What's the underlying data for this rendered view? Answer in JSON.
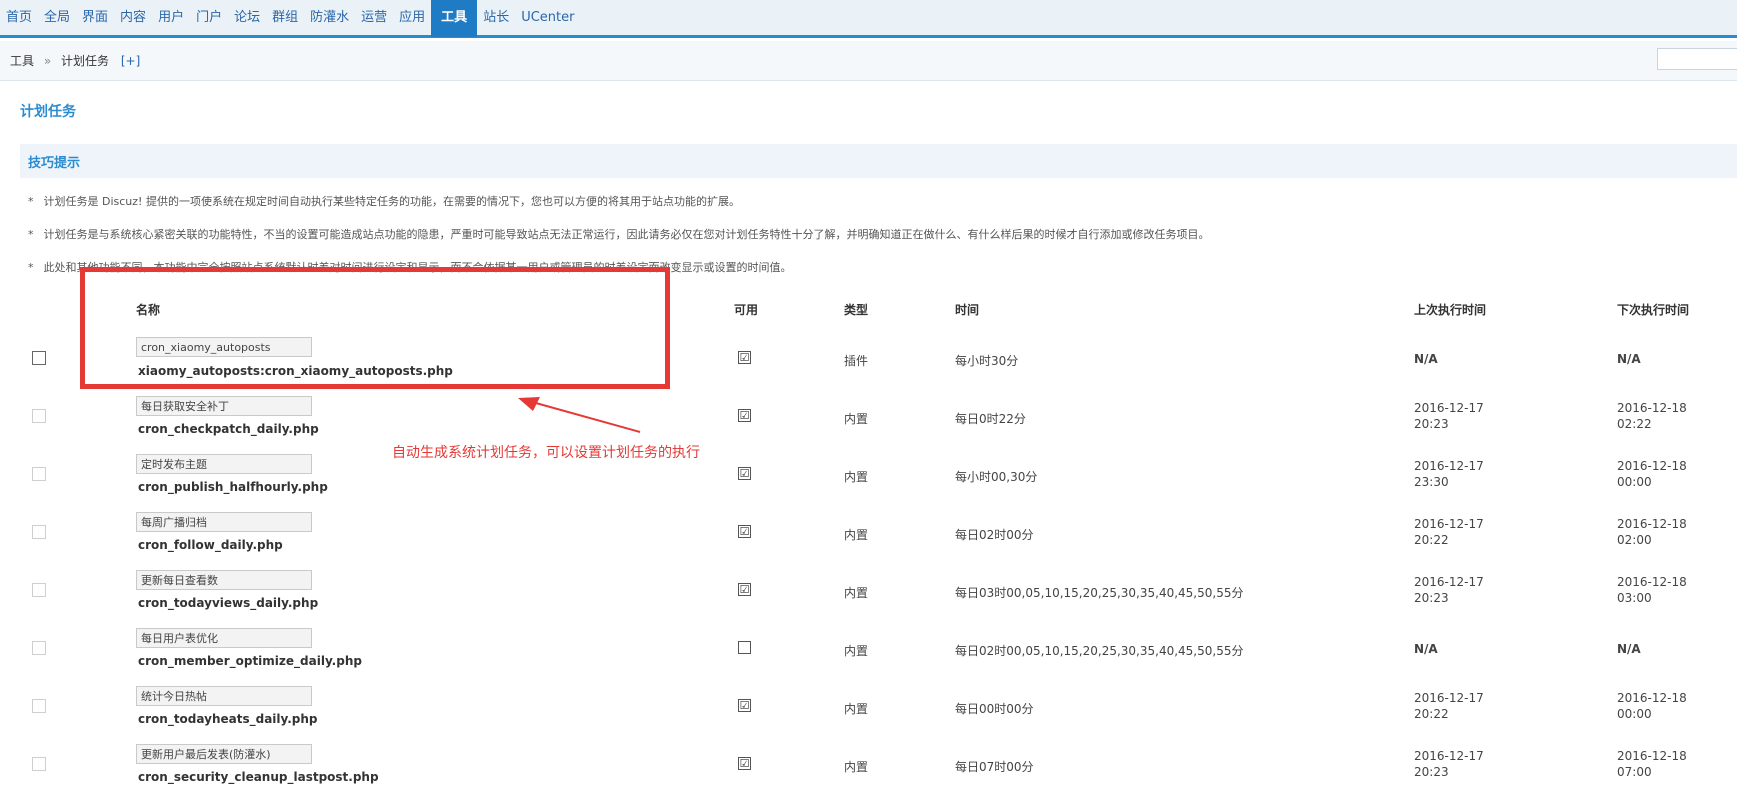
{
  "nav": {
    "items": [
      "首页",
      "全局",
      "界面",
      "内容",
      "用户",
      "门户",
      "论坛",
      "群组",
      "防灌水",
      "运营",
      "应用",
      "工具",
      "站长",
      "UCenter"
    ],
    "active_index": 11
  },
  "breadcrumb": {
    "part1": "工具",
    "sep": "»",
    "part2": "计划任务",
    "add": "[+]"
  },
  "search": {
    "value": ""
  },
  "page_title": "计划任务",
  "tips": {
    "title": "技巧提示",
    "items": [
      "计划任务是 Discuz! 提供的一项使系统在规定时间自动执行某些特定任务的功能，在需要的情况下，您也可以方便的将其用于站点功能的扩展。",
      "计划任务是与系统核心紧密关联的功能特性，不当的设置可能造成站点功能的隐患，严重时可能导致站点无法正常运行，因此请务必仅在您对计划任务特性十分了解，并明确知道正在做什么、有什么样后果的时候才自行添加或修改任务项目。",
      "此处和其他功能不同，本功能中完全按照站点系统默认时差对时间进行设定和显示，而不会依据某一用户或管理员的时差设定而改变显示或设置的时间值。"
    ]
  },
  "table": {
    "headers": {
      "name": "名称",
      "enabled": "可用",
      "type": "类型",
      "time": "时间",
      "last_run": "上次执行时间",
      "next_run": "下次执行时间"
    },
    "rows": [
      {
        "title": "cron_xiaomy_autoposts",
        "file": "xiaomy_autoposts:cron_xiaomy_autoposts.php",
        "enabled": true,
        "type": "插件",
        "time": "每小时30分",
        "last_run": "N/A",
        "next_run": "N/A"
      },
      {
        "title": "每日获取安全补丁",
        "file": "cron_checkpatch_daily.php",
        "enabled": true,
        "type": "内置",
        "time": "每日0时22分",
        "last_run": [
          "2016-12-17",
          "20:23"
        ],
        "next_run": [
          "2016-12-18",
          "02:22"
        ]
      },
      {
        "title": "定时发布主题",
        "file": "cron_publish_halfhourly.php",
        "enabled": true,
        "type": "内置",
        "time": "每小时00,30分",
        "last_run": [
          "2016-12-17",
          "23:30"
        ],
        "next_run": [
          "2016-12-18",
          "00:00"
        ]
      },
      {
        "title": "每周广播归档",
        "file": "cron_follow_daily.php",
        "enabled": true,
        "type": "内置",
        "time": "每日02时00分",
        "last_run": [
          "2016-12-17",
          "20:22"
        ],
        "next_run": [
          "2016-12-18",
          "02:00"
        ]
      },
      {
        "title": "更新每日查看数",
        "file": "cron_todayviews_daily.php",
        "enabled": true,
        "type": "内置",
        "time": "每日03时00,05,10,15,20,25,30,35,40,45,50,55分",
        "last_run": [
          "2016-12-17",
          "20:23"
        ],
        "next_run": [
          "2016-12-18",
          "03:00"
        ]
      },
      {
        "title": "每日用户表优化",
        "file": "cron_member_optimize_daily.php",
        "enabled": false,
        "type": "内置",
        "time": "每日02时00,05,10,15,20,25,30,35,40,45,50,55分",
        "last_run": "N/A",
        "next_run": "N/A"
      },
      {
        "title": "统计今日热帖",
        "file": "cron_todayheats_daily.php",
        "enabled": true,
        "type": "内置",
        "time": "每日00时00分",
        "last_run": [
          "2016-12-17",
          "20:22"
        ],
        "next_run": [
          "2016-12-18",
          "00:00"
        ]
      },
      {
        "title": "更新用户最后发表(防灌水)",
        "file": "cron_security_cleanup_lastpost.php",
        "enabled": true,
        "type": "内置",
        "time": "每日07时00分",
        "last_run": [
          "2016-12-17",
          "20:23"
        ],
        "next_run": [
          "2016-12-18",
          "07:00"
        ]
      }
    ]
  },
  "annotation": {
    "text": "自动生成系统计划任务，可以设置计划任务的执行",
    "color": "#e53935"
  },
  "colors": {
    "accent": "#2a8cd0",
    "nav_active": "#1f7cc4",
    "annotation": "#e53935"
  }
}
